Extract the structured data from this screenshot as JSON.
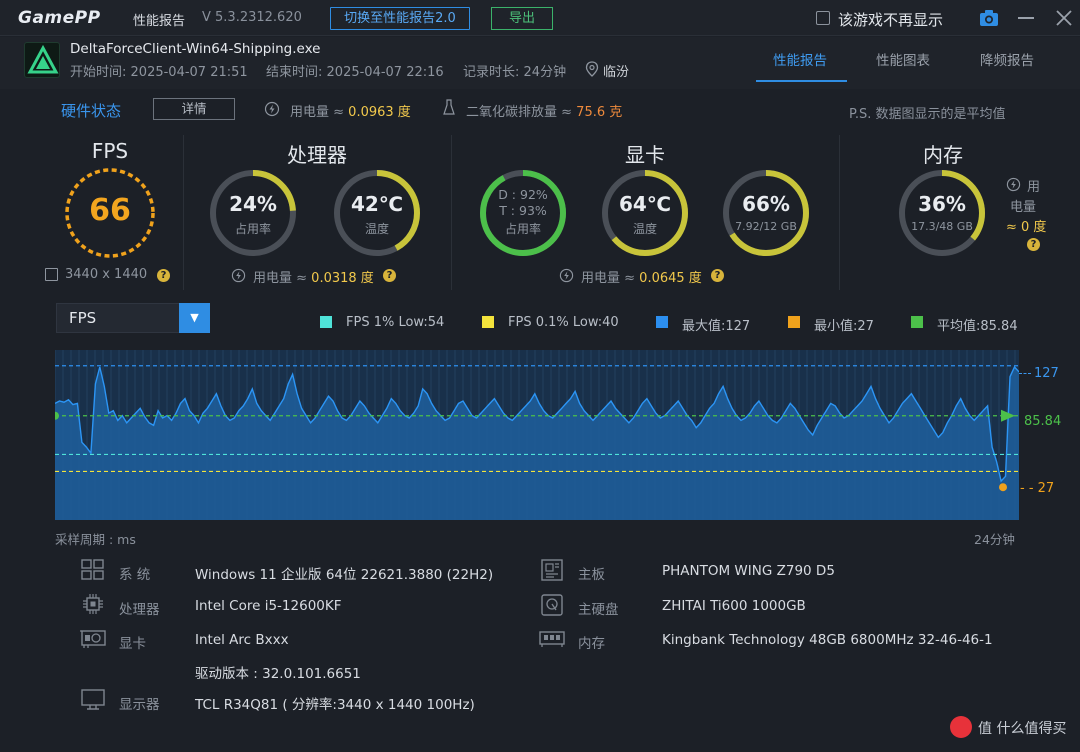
{
  "titlebar": {
    "logo": "GamePP",
    "title": "性能报告",
    "version": "V 5.3.2312.620",
    "switch_button": "切换至性能报告2.0",
    "export_button": "导出",
    "checkbox_label": "该游戏不再显示"
  },
  "session": {
    "exe": "DeltaForceClient-Win64-Shipping.exe",
    "start_label": "开始时间:",
    "start": "2025-04-07 21:51",
    "end_label": "结束时间:",
    "end": "2025-04-07 22:16",
    "duration_label": "记录时长:",
    "duration": "24分钟",
    "location": "临汾"
  },
  "tabs": [
    {
      "label": "性能报告",
      "active": true
    },
    {
      "label": "性能图表",
      "active": false
    },
    {
      "label": "降频报告",
      "active": false
    }
  ],
  "hardware": {
    "title": "硬件状态",
    "detail_button": "详情",
    "power_label": "用电量 ≈",
    "power_value": "0.0963 度",
    "co2_label": "二氧化碳排放量 ≈",
    "co2_value": "75.6 克",
    "note": "P.S. 数据图显示的是平均值"
  },
  "fps_panel": {
    "title": "FPS",
    "value": "66",
    "resolution": "3440 x 1440"
  },
  "cpu_panel": {
    "title": "处理器",
    "usage": {
      "value": "24%",
      "label": "占用率",
      "level": 0.24
    },
    "temp": {
      "value": "42℃",
      "label": "温度",
      "level": 0.42
    },
    "power_label": "用电量 ≈",
    "power_value": "0.0318 度"
  },
  "gpu_panel": {
    "title": "显卡",
    "usage": {
      "d": "D : 92%",
      "t": "T : 93%",
      "label": "占用率",
      "level": 0.92
    },
    "temp": {
      "value": "64℃",
      "label": "温度",
      "level": 0.64
    },
    "vram": {
      "value": "66%",
      "label": "7.92/12 GB",
      "level": 0.66
    },
    "power_label": "用电量 ≈",
    "power_value": "0.0645 度"
  },
  "mem_panel": {
    "title": "内存",
    "usage": {
      "value": "36%",
      "label": "17.3/48 GB",
      "level": 0.36
    },
    "power_line1": "用",
    "power_line2": "电量",
    "power_value": "≈ 0 度"
  },
  "chart_controls": {
    "metric": "FPS",
    "legend": [
      {
        "label": "FPS 1% Low:54",
        "color": "#4fe3d9"
      },
      {
        "label": "FPS 0.1% Low:40",
        "color": "#f3e33c"
      },
      {
        "label": "最大值:127",
        "color": "#2c8ff0"
      },
      {
        "label": "最小值:27",
        "color": "#f0a21c"
      },
      {
        "label": "平均值:85.84",
        "color": "#4cc04a"
      }
    ]
  },
  "chart_data": {
    "type": "area",
    "series": [
      {
        "name": "FPS",
        "values": [
          96,
          98,
          97,
          99,
          95,
          96,
          64,
          60,
          55,
          112,
          126,
          110,
          88,
          90,
          82,
          86,
          80,
          84,
          88,
          92,
          85,
          80,
          78,
          90,
          84,
          86,
          82,
          88,
          96,
          100,
          90,
          86,
          80,
          88,
          92,
          98,
          104,
          94,
          86,
          82,
          84,
          90,
          94,
          100,
          108,
          96,
          90,
          86,
          82,
          88,
          94,
          100,
          112,
          120,
          104,
          92,
          86,
          80,
          84,
          90,
          96,
          102,
          98,
          90,
          84,
          82,
          86,
          92,
          98,
          94,
          88,
          84,
          80,
          86,
          92,
          100,
          96,
          90,
          86,
          84,
          88,
          94,
          108,
          104,
          96,
          90,
          86,
          82,
          84,
          90,
          96,
          98,
          92,
          86,
          84,
          88,
          92,
          96,
          100,
          94,
          88,
          84,
          82,
          86,
          90,
          94,
          98,
          104,
          96,
          90,
          86,
          84,
          88,
          92,
          96,
          100,
          106,
          96,
          90,
          86,
          82,
          86,
          90,
          94,
          98,
          92,
          88,
          84,
          80,
          84,
          90,
          96,
          100,
          94,
          88,
          84,
          86,
          90,
          94,
          98,
          92,
          86,
          82,
          76,
          80,
          86,
          92,
          96,
          104,
          110,
          100,
          92,
          86,
          82,
          84,
          88,
          94,
          98,
          92,
          86,
          82,
          80,
          84,
          90,
          96,
          92,
          86,
          80,
          74,
          70,
          78,
          84,
          90,
          96,
          94,
          88,
          84,
          86,
          90,
          94,
          98,
          104,
          110,
          100,
          92,
          86,
          80,
          84,
          90,
          96,
          100,
          104,
          98,
          92,
          86,
          80,
          74,
          68,
          72,
          80,
          86,
          94,
          100,
          92,
          86,
          82,
          86,
          90,
          94,
          60,
          48,
          32,
          36,
          118,
          126,
          122
        ]
      }
    ],
    "y_max": 127,
    "y_avg": 85.84,
    "y_min": 27,
    "y_axis_labels": [
      "127",
      "85.84",
      "27"
    ],
    "x_start_label": "采样周期 : ms",
    "x_end_label": "24分钟"
  },
  "specs": [
    {
      "key": "系  统",
      "value": "Windows 11 企业版 64位 22621.3880 (22H2)",
      "icon": "monitor-grid-icon"
    },
    {
      "key": "处理器",
      "value": "Intel Core i5-12600KF",
      "icon": "cpu-icon"
    },
    {
      "key": "显卡",
      "value": "Intel Arc Bxxx",
      "icon": "gpu-icon"
    },
    {
      "key": "",
      "value": "驱动版本 : 32.0.101.6651",
      "icon": ""
    },
    {
      "key": "显示器",
      "value": "TCL R34Q81 ( 分辨率:3440 x 1440 100Hz)",
      "icon": "display-icon"
    },
    {
      "key": "主板",
      "value": "PHANTOM WING Z790 D5",
      "icon": "motherboard-icon"
    },
    {
      "key": "主硬盘",
      "value": "ZHITAI Ti600 1000GB",
      "icon": "disk-icon"
    },
    {
      "key": "内存",
      "value": "Kingbank Technology 48GB 6800MHz 32-46-46-1",
      "icon": "memory-icon"
    }
  ],
  "watermark": "值 什么值得买"
}
